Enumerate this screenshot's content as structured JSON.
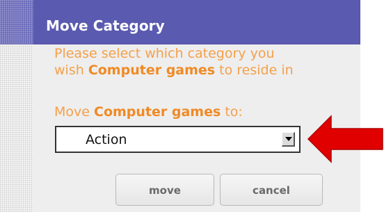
{
  "dialog": {
    "title": "Move Category",
    "instruction_line1": "Please select which category you",
    "instruction_line2_prefix": "wish ",
    "category_name": "Computer games",
    "instruction_line2_suffix": " to reside in",
    "move_prefix": "Move ",
    "move_suffix": " to:",
    "select": {
      "selected_value": "Action",
      "dropdown_icon": "triangle-down-icon"
    },
    "buttons": {
      "move_label": "move",
      "cancel_label": "cancel"
    }
  },
  "annotation": {
    "arrow_icon": "red-arrow-left-icon",
    "arrow_color": "#e00000"
  },
  "colors": {
    "title_bar": "#5a5ab0",
    "instruction_text": "#f5a04a",
    "instruction_bold": "#f08a25",
    "dialog_background": "#eeeeee"
  }
}
